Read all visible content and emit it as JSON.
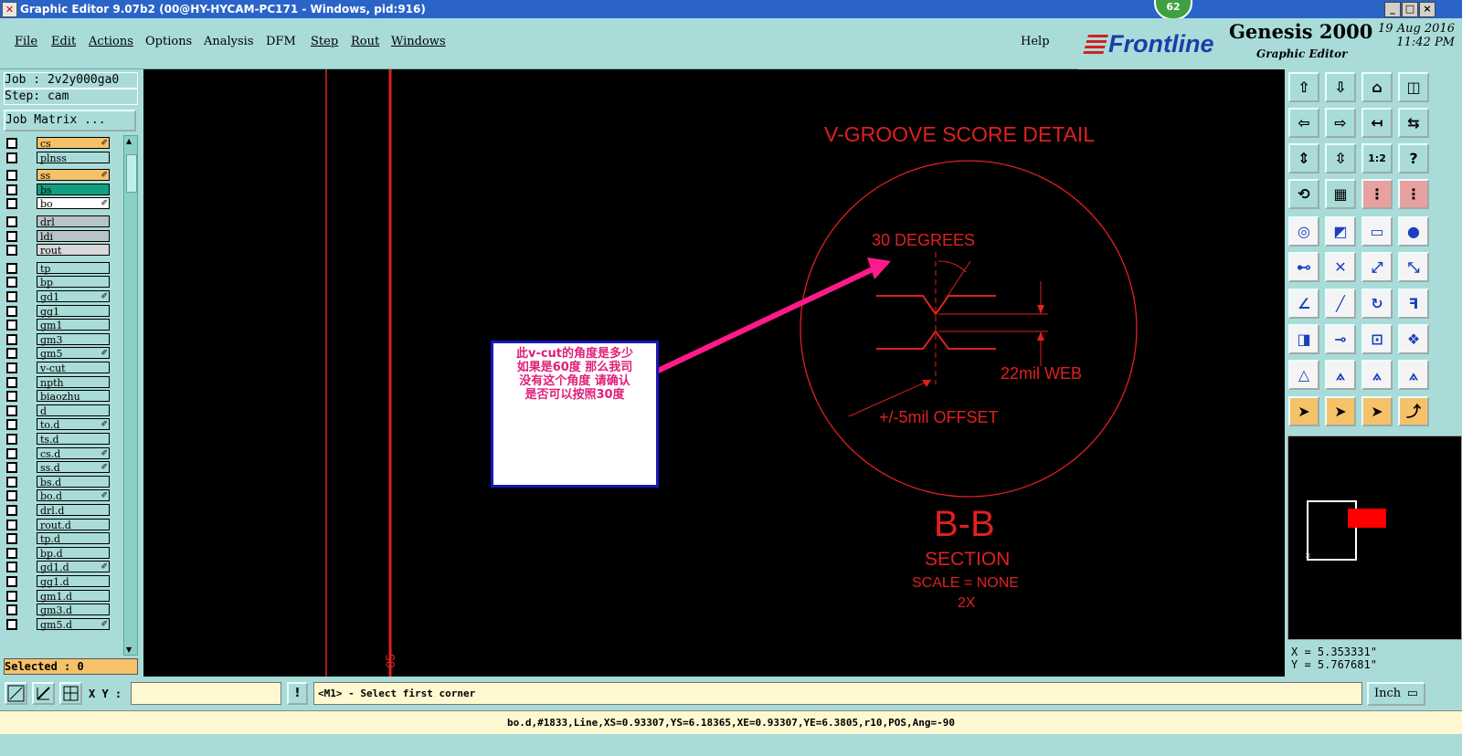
{
  "window": {
    "title": "Graphic Editor 9.07b2 (00@HY-HYCAM-PC171 - Windows, pid:916)",
    "notification_count": "62"
  },
  "menu": {
    "file": "File",
    "edit": "Edit",
    "actions": "Actions",
    "options": "Options",
    "analysis": "Analysis",
    "dfm": "DFM",
    "step": "Step",
    "rout": "Rout",
    "windows": "Windows",
    "help": "Help"
  },
  "branding": {
    "logo": "Frontline",
    "product": "Genesis 2000",
    "subtitle": "Graphic Editor",
    "date": "19 Aug 2016",
    "time": "11:42 PM"
  },
  "left_panel": {
    "job": "Job : 2v2y000ga0",
    "step": "Step: cam",
    "job_matrix": "Job Matrix ...",
    "selected": "Selected : 0",
    "layers": [
      {
        "name": "cs",
        "color": "#f5c26a",
        "mark": true
      },
      {
        "name": "plnss",
        "color": "#a9dcd9",
        "mark": false
      },
      {
        "name": "ss",
        "color": "#f5c26a",
        "mark": true
      },
      {
        "name": "bs",
        "color": "#10a080",
        "mark": false
      },
      {
        "name": "bo",
        "color": "#ffffff",
        "mark": true
      },
      {
        "name": "drl",
        "color": "#b8c4c8",
        "mark": false
      },
      {
        "name": "ldi",
        "color": "#b8c4c8",
        "mark": false
      },
      {
        "name": "rout",
        "color": "#d8d8d8",
        "mark": false
      },
      {
        "name": "tp",
        "color": "#a9dcd9",
        "mark": false
      },
      {
        "name": "bp",
        "color": "#a9dcd9",
        "mark": false
      },
      {
        "name": "gd1",
        "color": "#a9dcd9",
        "mark": true
      },
      {
        "name": "gg1",
        "color": "#a9dcd9",
        "mark": false
      },
      {
        "name": "gm1",
        "color": "#a9dcd9",
        "mark": false
      },
      {
        "name": "gm3",
        "color": "#a9dcd9",
        "mark": false
      },
      {
        "name": "gm5",
        "color": "#a9dcd9",
        "mark": true
      },
      {
        "name": "v-cut",
        "color": "#a9dcd9",
        "mark": false
      },
      {
        "name": "npth",
        "color": "#a9dcd9",
        "mark": false
      },
      {
        "name": "biaozhu",
        "color": "#a9dcd9",
        "mark": false
      },
      {
        "name": "d",
        "color": "#a9dcd9",
        "mark": false
      },
      {
        "name": "to.d",
        "color": "#a9dcd9",
        "mark": true
      },
      {
        "name": "ts.d",
        "color": "#a9dcd9",
        "mark": false
      },
      {
        "name": "cs.d",
        "color": "#a9dcd9",
        "mark": true
      },
      {
        "name": "ss.d",
        "color": "#a9dcd9",
        "mark": true
      },
      {
        "name": "bs.d",
        "color": "#a9dcd9",
        "mark": false
      },
      {
        "name": "bo.d",
        "color": "#a9dcd9",
        "mark": true
      },
      {
        "name": "drl.d",
        "color": "#a9dcd9",
        "mark": false
      },
      {
        "name": "rout.d",
        "color": "#a9dcd9",
        "mark": false
      },
      {
        "name": "tp.d",
        "color": "#a9dcd9",
        "mark": false
      },
      {
        "name": "bp.d",
        "color": "#a9dcd9",
        "mark": false
      },
      {
        "name": "gd1.d",
        "color": "#a9dcd9",
        "mark": true
      },
      {
        "name": "gg1.d",
        "color": "#a9dcd9",
        "mark": false
      },
      {
        "name": "gm1.d",
        "color": "#a9dcd9",
        "mark": false
      },
      {
        "name": "gm3.d",
        "color": "#a9dcd9",
        "mark": false
      },
      {
        "name": "gm5.d",
        "color": "#a9dcd9",
        "mark": true
      }
    ]
  },
  "canvas": {
    "note_lines": [
      "此v-cut的角度是多少",
      "如果是60度  那么我司",
      "没有这个角度  请确认",
      "是否可以按照30度"
    ],
    "title": "V-GROOVE SCORE DETAIL",
    "degrees": "30 DEGREES",
    "web": "22mil WEB",
    "offset": "+/-5mil OFFSET",
    "section_label": "B-B",
    "section": "SECTION",
    "scale": "SCALE = NONE",
    "factor": "2X",
    "vertical_label": "05"
  },
  "coords": {
    "x": "X = 5.353331\"",
    "y": "Y = 5.767681\""
  },
  "command": {
    "xy_label": "X Y :",
    "xy_value": "",
    "message": "<M1> - Select first corner",
    "unit": "Inch"
  },
  "status": "bo.d,#1833,Line,XS=0.93307,YS=6.18365,XE=0.93307,YE=6.3805,r10,POS,Ang=-90",
  "icons": [
    "app-icon",
    "minimize-icon",
    "maximize-icon",
    "close-icon",
    "zoom-home-icon",
    "pan-icon",
    "snap-icon",
    "info-icon",
    "scroll-up-icon",
    "scroll-down-icon",
    "unit-dropdown-icon"
  ]
}
